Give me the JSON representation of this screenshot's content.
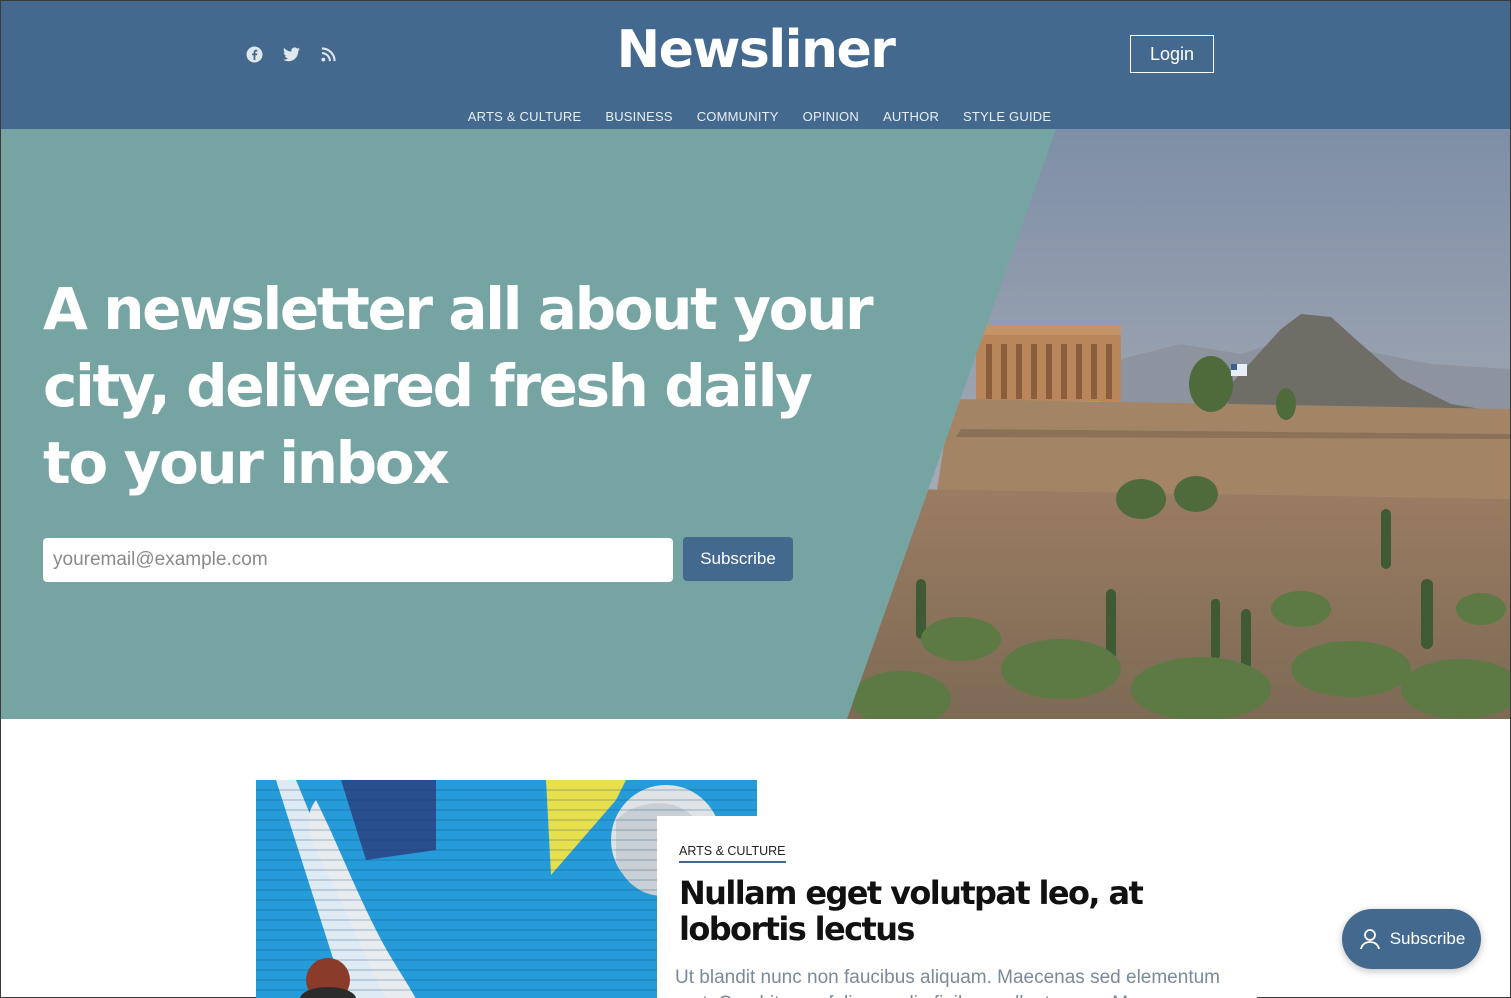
{
  "header": {
    "brand": "Newsliner",
    "login_label": "Login",
    "social": [
      "facebook-icon",
      "twitter-icon",
      "rss-icon"
    ]
  },
  "nav": {
    "items": [
      "ARTS & CULTURE",
      "BUSINESS",
      "COMMUNITY",
      "OPINION",
      "AUTHOR",
      "STYLE GUIDE"
    ]
  },
  "hero": {
    "headline": "A newsletter all about your city, delivered fresh daily to your inbox",
    "email_placeholder": "youremail@example.com",
    "subscribe_label": "Subscribe"
  },
  "article": {
    "tag": "ARTS & CULTURE",
    "title": "Nullam eget volutpat leo, at lobortis lectus",
    "excerpt": "Ut blandit nunc non faucibus aliquam. Maecenas sed elementum erat. Curabitur eu felis ac odio finibus pellentesque. Maecenas"
  },
  "floating": {
    "subscribe_label": "Subscribe"
  },
  "colors": {
    "brand": "#44698f",
    "hero_bg": "#75a4a2"
  }
}
